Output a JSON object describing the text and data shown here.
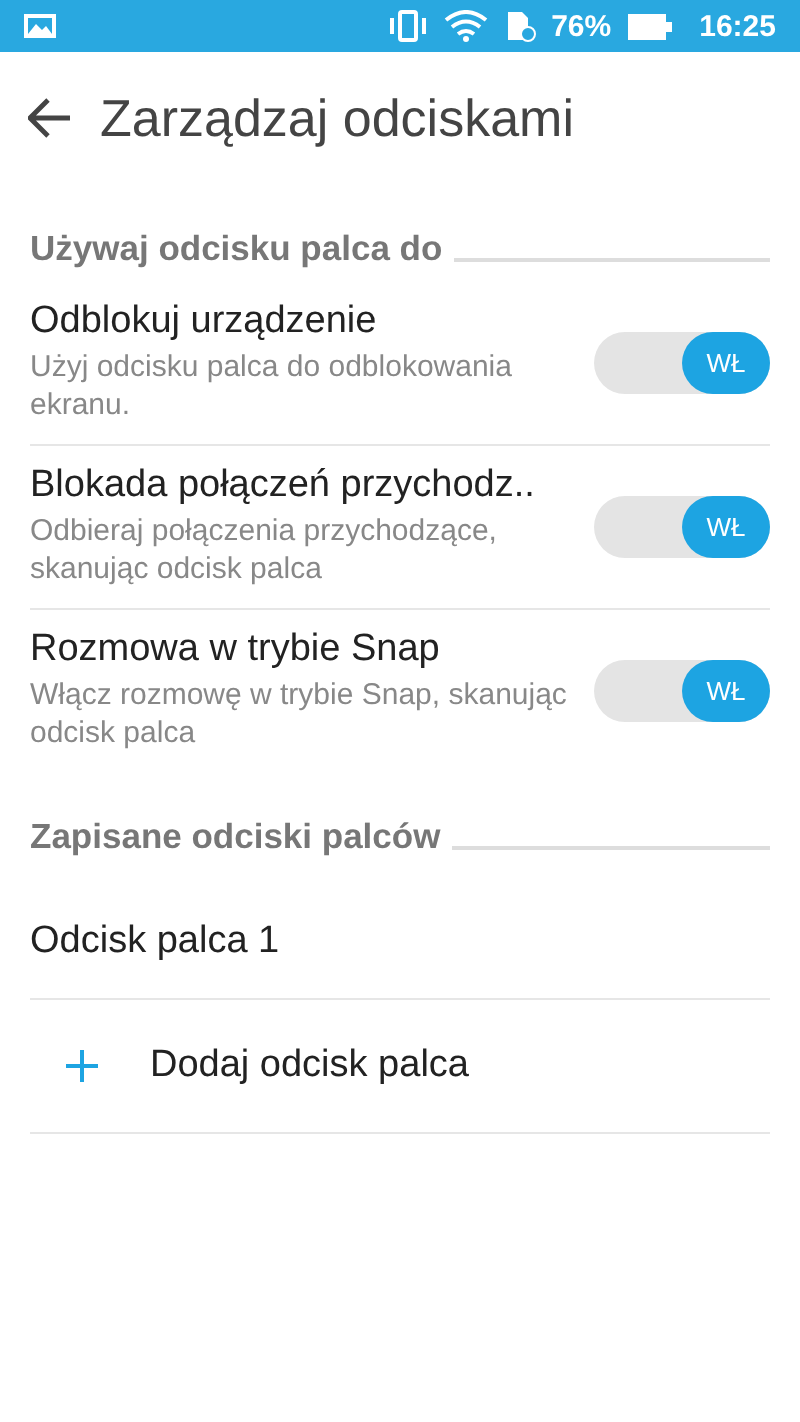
{
  "status_bar": {
    "battery": "76%",
    "time": "16:25"
  },
  "toolbar": {
    "title": "Zarządzaj odciskami"
  },
  "sections": [
    {
      "header": "Używaj odcisku palca do",
      "items": [
        {
          "kind": "toggle",
          "title": "Odblokuj urządzenie",
          "summary": "Użyj odcisku palca do odblokowania ekranu.",
          "on": true,
          "switch_label": "WŁ"
        },
        {
          "kind": "toggle",
          "title": "Blokada połączeń przychodz..",
          "summary": "Odbieraj połączenia przychodzące, skanując odcisk palca",
          "on": true,
          "switch_label": "WŁ"
        },
        {
          "kind": "toggle",
          "title": "Rozmowa w trybie Snap",
          "summary": "Włącz rozmowę w trybie Snap, skanując odcisk palca",
          "on": true,
          "switch_label": "WŁ"
        }
      ]
    },
    {
      "header": "Zapisane odciski palców",
      "items": [
        {
          "kind": "entry",
          "title": "Odcisk palca 1"
        },
        {
          "kind": "add",
          "title": "Dodaj odcisk palca"
        }
      ]
    }
  ]
}
